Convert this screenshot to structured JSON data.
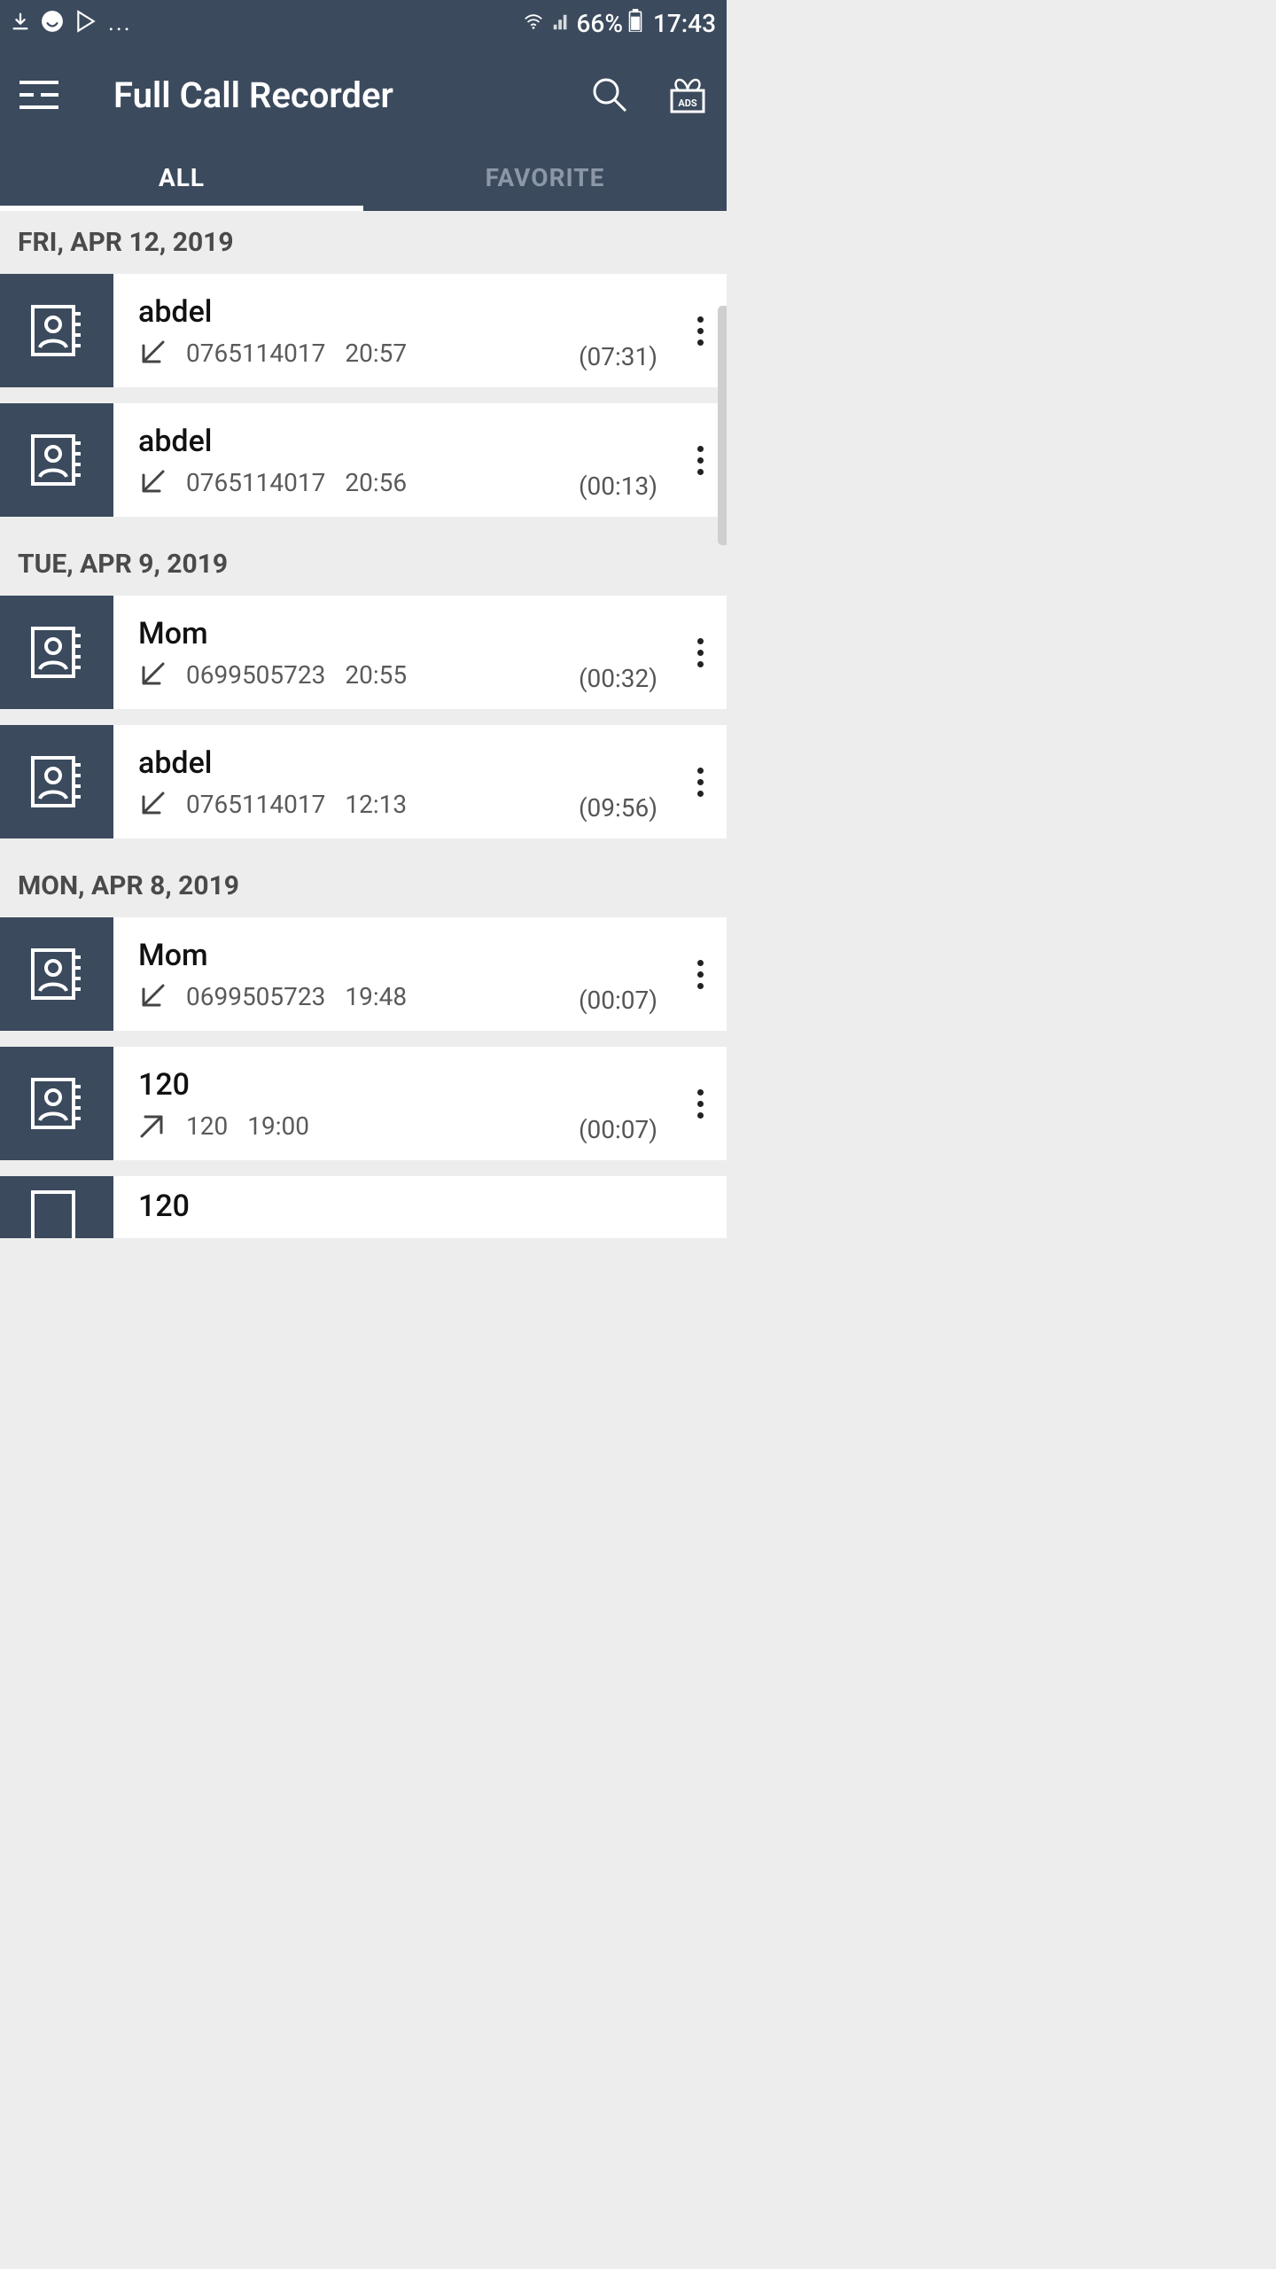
{
  "statusbar": {
    "battery_pct": "66%",
    "clock": "17:43"
  },
  "appbar": {
    "title": "Full Call Recorder"
  },
  "tabs": {
    "all": "ALL",
    "favorite": "FAVORITE"
  },
  "groups": [
    {
      "date": "FRI, APR 12, 2019",
      "calls": [
        {
          "name": "abdel",
          "number": "0765114017",
          "time": "20:57",
          "duration": "(07:31)",
          "direction": "in"
        },
        {
          "name": "abdel",
          "number": "0765114017",
          "time": "20:56",
          "duration": "(00:13)",
          "direction": "in"
        }
      ]
    },
    {
      "date": "TUE, APR 9, 2019",
      "calls": [
        {
          "name": "Mom",
          "number": "0699505723",
          "time": "20:55",
          "duration": "(00:32)",
          "direction": "in"
        },
        {
          "name": "abdel",
          "number": "0765114017",
          "time": "12:13",
          "duration": "(09:56)",
          "direction": "in"
        }
      ]
    },
    {
      "date": "MON, APR 8, 2019",
      "calls": [
        {
          "name": "Mom",
          "number": "0699505723",
          "time": "19:48",
          "duration": "(00:07)",
          "direction": "in"
        },
        {
          "name": "120",
          "number": "120",
          "time": "19:00",
          "duration": "(00:07)",
          "direction": "out"
        },
        {
          "name": "120",
          "number": "",
          "time": "",
          "duration": "",
          "direction": ""
        }
      ]
    }
  ]
}
